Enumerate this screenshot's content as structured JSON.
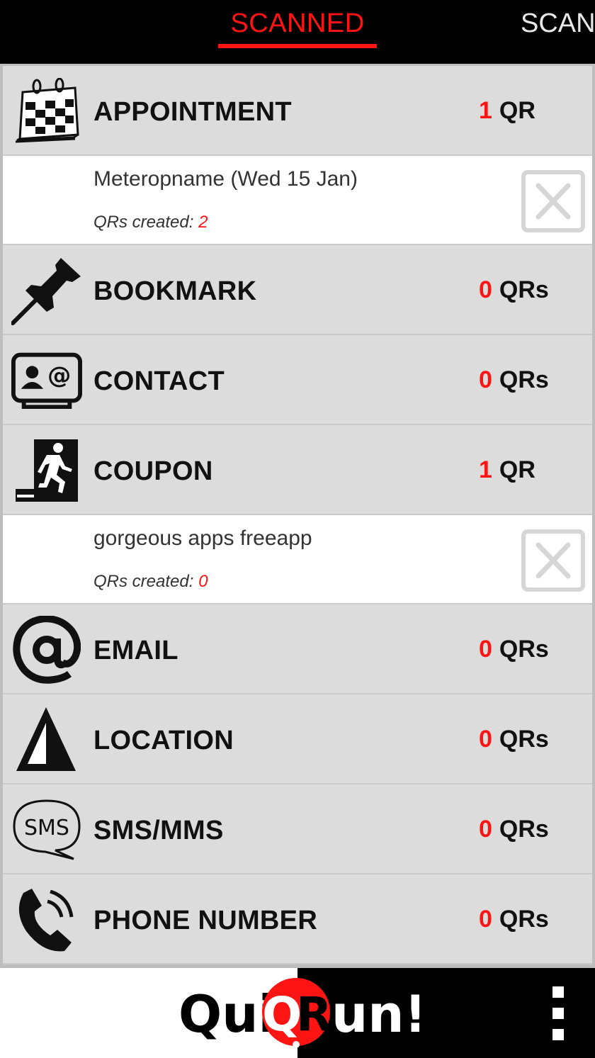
{
  "tabs": {
    "active": "SCANNED",
    "next": "SCAN"
  },
  "colors": {
    "accent": "#ff1414",
    "row_bg": "#dcdcdc",
    "sub_bg": "#ffffff"
  },
  "categories": [
    {
      "label": "APPOINTMENT",
      "count": "1",
      "unit": "QR",
      "icon": "calendar-icon"
    },
    {
      "label": "BOOKMARK",
      "count": "0",
      "unit": "QRs",
      "icon": "pushpin-icon"
    },
    {
      "label": "CONTACT",
      "count": "0",
      "unit": "QRs",
      "icon": "contact-card-icon"
    },
    {
      "label": "COUPON",
      "count": "1",
      "unit": "QR",
      "icon": "exit-runner-icon"
    },
    {
      "label": "EMAIL",
      "count": "0",
      "unit": "QRs",
      "icon": "at-sign-icon"
    },
    {
      "label": "LOCATION",
      "count": "0",
      "unit": "QRs",
      "icon": "navigation-arrow-icon"
    },
    {
      "label": "SMS/MMS",
      "count": "0",
      "unit": "QRs",
      "icon": "sms-bubble-icon"
    },
    {
      "label": "PHONE NUMBER",
      "count": "0",
      "unit": "QRs",
      "icon": "phone-handset-icon"
    }
  ],
  "items": [
    {
      "title": "Meteropname (Wed 15 Jan)",
      "created_label": "QRs created:",
      "created_count": "2"
    },
    {
      "title": "gorgeous apps freeapp",
      "created_label": "QRs created:",
      "created_count": "0"
    }
  ],
  "logo": {
    "part1": "Qui",
    "q": "Q",
    "r": "R",
    "part2": "un!"
  }
}
